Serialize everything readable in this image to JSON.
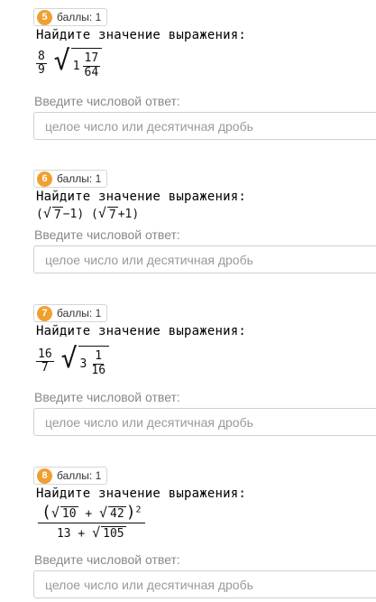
{
  "common": {
    "title": "Найдите значение выражения:",
    "answer_label": "Введите числовой ответ:",
    "placeholder": "целое число или десятичная дробь"
  },
  "tasks": [
    {
      "num": "5",
      "points": "баллы: 1",
      "expr": {
        "frac_n": "8",
        "frac_d": "9",
        "whole": "1",
        "inner_n": "17",
        "inner_d": "64"
      }
    },
    {
      "num": "6",
      "points": "баллы: 1",
      "expr": {
        "open1": "(",
        "r1": "7",
        "minus": "−1)",
        "open2": "(",
        "r2": "7",
        "plus": "+1)"
      }
    },
    {
      "num": "7",
      "points": "баллы: 1",
      "expr": {
        "frac_n": "16",
        "frac_d": "7",
        "whole": "3",
        "inner_n": "1",
        "inner_d": "16"
      }
    },
    {
      "num": "8",
      "points": "баллы: 1",
      "expr": {
        "r1": "10",
        "plus": "+",
        "r2": "42",
        "exp": "2",
        "den_a": "13 +",
        "den_r": "105"
      }
    }
  ]
}
